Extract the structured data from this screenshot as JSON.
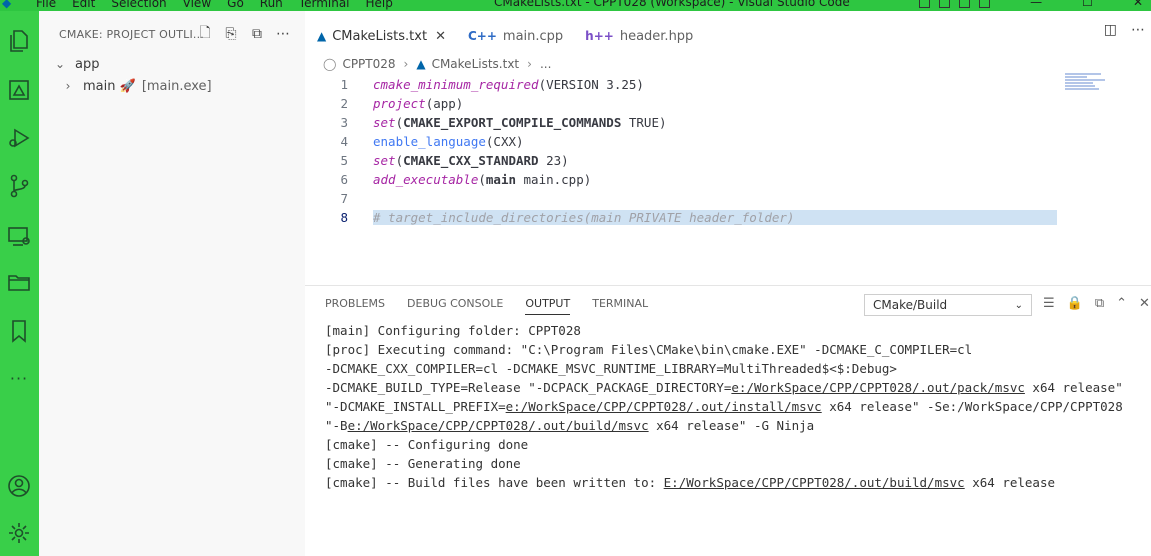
{
  "window": {
    "title": "CMakeLists.txt - CPPT028 (Workspace) - Visual Studio Code",
    "menu": [
      "File",
      "Edit",
      "Selection",
      "View",
      "Go",
      "Run",
      "Terminal",
      "Help"
    ]
  },
  "sidebar": {
    "header": "CMAKE: PROJECT OUTLI...",
    "tree": [
      {
        "label": "app",
        "chevron": "⌄"
      },
      {
        "label": "main 🚀",
        "chevron": "›",
        "desc": "[main.exe]"
      }
    ]
  },
  "tabs": [
    {
      "label": "CMakeLists.txt",
      "icon": "cmake-icon",
      "active": true
    },
    {
      "label": "main.cpp",
      "icon": "cpp-icon"
    },
    {
      "label": "header.hpp",
      "icon": "hpp-icon"
    }
  ],
  "breadcrumb": {
    "folder": "CPPT028",
    "file": "CMakeLists.txt",
    "more": "..."
  },
  "code": {
    "lines": [
      {
        "n": "1"
      },
      {
        "n": "2"
      },
      {
        "n": "3"
      },
      {
        "n": "4"
      },
      {
        "n": "5"
      },
      {
        "n": "6"
      },
      {
        "n": "7"
      },
      {
        "n": "8"
      }
    ]
  },
  "panel": {
    "tabs": [
      "PROBLEMS",
      "DEBUG CONSOLE",
      "OUTPUT",
      "TERMINAL"
    ],
    "active_tab": "OUTPUT",
    "channel": "CMake/Build"
  },
  "colors": {
    "title_bar": "#2ec641",
    "activity_bar": "#39cf49"
  }
}
